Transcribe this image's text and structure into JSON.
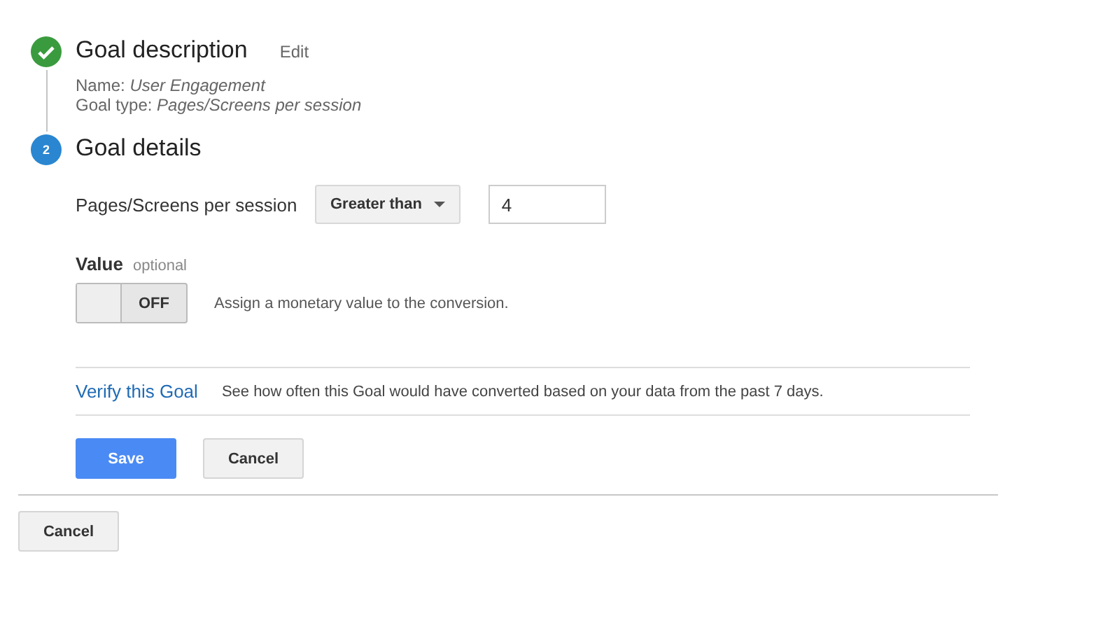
{
  "steps": [
    {
      "kind": "done",
      "title": "Goal description",
      "action": "Edit",
      "details": [
        {
          "label": "Name:",
          "value": "User Engagement"
        },
        {
          "label": "Goal type:",
          "value": "Pages/Screens per session"
        }
      ]
    },
    {
      "kind": "active",
      "number": "2",
      "title": "Goal details"
    }
  ],
  "condition": {
    "label": "Pages/Screens per session",
    "operator": "Greater than",
    "value": "4"
  },
  "value_setting": {
    "label": "Value",
    "hint": "optional",
    "toggle": {
      "on": false,
      "label": "OFF"
    },
    "description": "Assign a monetary value to the conversion."
  },
  "verify": {
    "link": "Verify this Goal",
    "description": "See how often this Goal would have converted based on your data from the past 7 days."
  },
  "buttons": [
    {
      "kind": "primary",
      "label": "Save"
    },
    {
      "kind": "secondary",
      "label": "Cancel"
    }
  ],
  "footer_button": "Cancel"
}
